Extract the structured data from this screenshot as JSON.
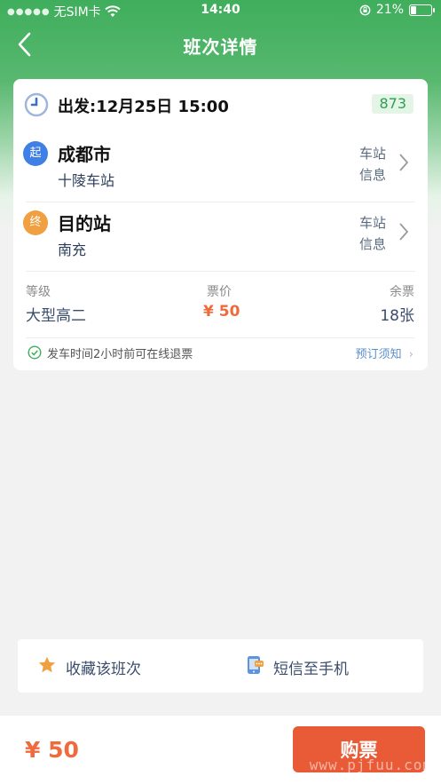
{
  "status_bar": {
    "carrier": "无SIM卡",
    "time": "14:40",
    "battery": "21%"
  },
  "nav": {
    "title": "班次详情"
  },
  "departure": {
    "label": "出发:12月25日 15:00",
    "bus_number": "873"
  },
  "from": {
    "badge": "起",
    "city": "成都市",
    "station": "十陵车站",
    "info_line1": "车站",
    "info_line2": "信息"
  },
  "to": {
    "badge": "终",
    "city": "目的站",
    "station": "南充",
    "info_line1": "车站",
    "info_line2": "信息"
  },
  "details": {
    "grade_label": "等级",
    "grade_value": "大型高二",
    "price_label": "票价",
    "price_value": "¥ 50",
    "seats_label": "余票",
    "seats_value": "18张"
  },
  "refund": {
    "text": "发车时间2小时前可在线退票",
    "link": "预订须知"
  },
  "actions": {
    "favorite": "收藏该班次",
    "sms": "短信至手机"
  },
  "purchase": {
    "price": "¥ 50",
    "button": "购票"
  },
  "watermark": "www.pjfuu.com",
  "colors": {
    "brand_green": "#3fae5c",
    "accent_orange": "#e95a36",
    "price_orange": "#ef6a3c",
    "from_blue": "#3f7fe6",
    "to_orange": "#f0a040"
  }
}
